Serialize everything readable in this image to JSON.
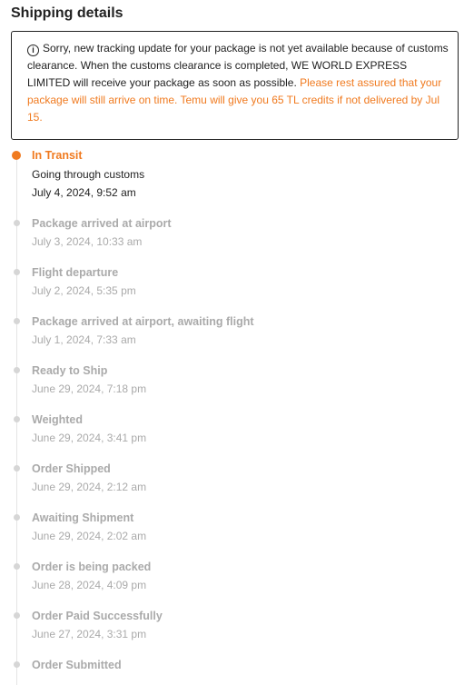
{
  "page": {
    "title": "Shipping details"
  },
  "notice": {
    "icon": "info-icon",
    "text": "Sorry, new tracking update for your package is not yet available because of customs clearance. When the customs clearance is completed, WE WORLD EXPRESS LIMITED will receive your package as soon as possible. ",
    "highlight": "Please rest assured that your package will still arrive on time. Temu will give you 65 TL credits if not delivered by Jul 15.",
    "highlight_color": "#f07a1f"
  },
  "timeline": {
    "active_color": "#f07a1f",
    "inactive_color": "#aaaaaa",
    "current": {
      "title": "In Transit",
      "description": "Going through customs",
      "time": "July 4, 2024, 9:52 am"
    },
    "events": [
      {
        "title": "Package arrived at airport",
        "time": "July 3, 2024, 10:33 am"
      },
      {
        "title": "Flight departure",
        "time": "July 2, 2024, 5:35 pm"
      },
      {
        "title": "Package arrived at airport, awaiting flight",
        "time": "July 1, 2024, 7:33 am"
      },
      {
        "title": "Ready to Ship",
        "time": "June 29, 2024, 7:18 pm"
      },
      {
        "title": "Weighted",
        "time": "June 29, 2024, 3:41 pm"
      },
      {
        "title": "Order Shipped",
        "time": "June 29, 2024, 2:12 am"
      },
      {
        "title": "Awaiting Shipment",
        "time": "June 29, 2024, 2:02 am"
      },
      {
        "title": "Order is being packed",
        "time": "June 28, 2024, 4:09 pm"
      },
      {
        "title": "Order Paid Successfully",
        "time": "June 27, 2024, 3:31 pm"
      },
      {
        "title": "Order Submitted",
        "time": ""
      }
    ]
  }
}
